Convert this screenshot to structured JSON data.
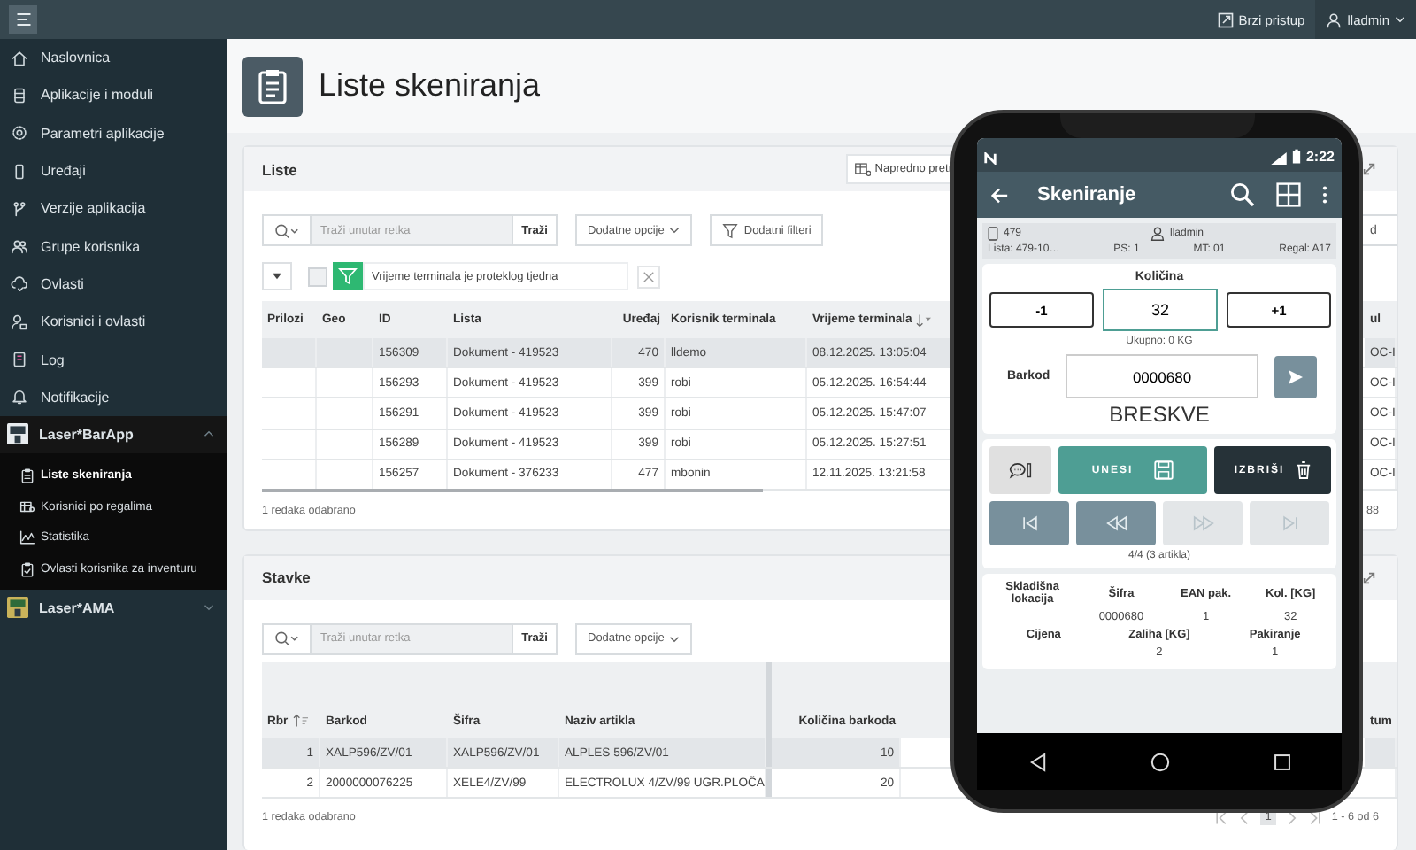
{
  "topbar": {
    "quick_access": "Brzi pristup",
    "user": "lladmin"
  },
  "sidebar": {
    "items": [
      {
        "label": "Naslovnica",
        "selected": false
      },
      {
        "label": "Aplikacije i moduli",
        "selected": false
      },
      {
        "label": "Parametri aplikacije",
        "selected": false
      },
      {
        "label": "Uređaji",
        "selected": false
      },
      {
        "label": "Verzije aplikacija",
        "selected": false
      },
      {
        "label": "Grupe korisnika",
        "selected": false
      },
      {
        "label": "Ovlasti",
        "selected": false
      },
      {
        "label": "Korisnici i ovlasti",
        "selected": false
      },
      {
        "label": "Log",
        "selected": false
      },
      {
        "label": "Notifikacije",
        "selected": false
      }
    ],
    "groups": [
      {
        "label": "Laser*BarApp",
        "expanded": true,
        "children": [
          {
            "label": "Liste skeniranja",
            "selected": true
          },
          {
            "label": "Korisnici po regalima",
            "selected": false
          },
          {
            "label": "Statistika",
            "selected": false
          },
          {
            "label": "Ovlasti korisnika za inventuru",
            "selected": false
          }
        ]
      },
      {
        "label": "Laser*AMA",
        "expanded": false
      }
    ]
  },
  "page": {
    "title": "Liste skeniranja"
  },
  "liste": {
    "title": "Liste",
    "advanced_search": "Napredno pretr",
    "search_placeholder": "Traži unutar retka",
    "search_button": "Traži",
    "options": "Dodatne opcije",
    "filters": "Dodatni filteri",
    "side_button": "d",
    "filter": {
      "text": "Vrijeme terminala je proteklog tjedna",
      "checked": false
    },
    "columns": [
      {
        "label": "Prilozi",
        "sorted": false
      },
      {
        "label": "Geo",
        "sorted": false
      },
      {
        "label": "ID",
        "sorted": false
      },
      {
        "label": "Lista",
        "sorted": false
      },
      {
        "label": "Uređaj",
        "sorted": false
      },
      {
        "label": "Korisnik terminala",
        "sorted": false
      },
      {
        "label": "Vrijeme terminala",
        "sorted": true
      },
      {
        "label": "ul",
        "sorted": false
      }
    ],
    "rows": [
      {
        "cells": [
          "",
          "",
          "156309",
          "Dokument - 419523",
          "470",
          "lldemo",
          "08.12.2025. 13:05:04",
          "OC-I"
        ],
        "selected": true
      },
      {
        "cells": [
          "",
          "",
          "156293",
          "Dokument - 419523",
          "399",
          "robi",
          "05.12.2025. 16:54:44",
          "OC-I"
        ],
        "selected": false
      },
      {
        "cells": [
          "",
          "",
          "156291",
          "Dokument - 419523",
          "399",
          "robi",
          "05.12.2025. 15:47:07",
          "OC-I"
        ],
        "selected": false
      },
      {
        "cells": [
          "",
          "",
          "156289",
          "Dokument - 419523",
          "399",
          "robi",
          "05.12.2025. 15:27:51",
          "OC-I"
        ],
        "selected": false
      },
      {
        "cells": [
          "",
          "",
          "156257",
          "Dokument - 376233",
          "477",
          "mbonin",
          "12.11.2025. 13:21:58",
          "OC-I"
        ],
        "selected": false
      }
    ],
    "footer": "1 redaka odabrano",
    "pager": "88"
  },
  "stavke": {
    "title": "Stavke",
    "search_placeholder": "Traži unutar retka",
    "search_button": "Traži",
    "options": "Dodatne opcije",
    "columns": [
      {
        "label": "Rbr",
        "sorted": true
      },
      {
        "label": "Barkod",
        "sorted": false
      },
      {
        "label": "Šifra",
        "sorted": false
      },
      {
        "label": "Naziv artikla",
        "sorted": false
      },
      {
        "label": "Količina barkoda",
        "sorted": false
      },
      {
        "label": "tum",
        "sorted": false
      }
    ],
    "rows": [
      {
        "cells": [
          "1",
          "XALP596/ZV/01",
          "XALP596/ZV/01",
          "ALPLES 596/ZV/01",
          "10",
          ""
        ],
        "selected": true
      },
      {
        "cells": [
          "2",
          "2000000076225",
          "XELE4/ZV/99",
          "ELECTROLUX 4/ZV/99 UGR.PLOČA",
          "20",
          ""
        ],
        "selected": false
      }
    ],
    "footer": "1 redaka odabrano",
    "pagination": {
      "pages": [
        {
          "label": "1",
          "selected": true
        }
      ],
      "range": "1 - 6 od 6"
    }
  },
  "phone": {
    "time": "2:22",
    "title": "Skeniranje",
    "device": "479",
    "user": "lladmin",
    "info": [
      "Lista: 479-10…",
      "PS: 1",
      "MT: 01",
      "Regal: A17"
    ],
    "quantity_label": "Količina",
    "minus": "-1",
    "quantity": "32",
    "plus": "+1",
    "total": "Ukupno: 0 KG",
    "barcode_label": "Barkod",
    "barcode": "0000680",
    "article": "BRESKVE",
    "enter": "UNESI",
    "delete": "IZBRIŠI",
    "nav": [
      {
        "kind": "first",
        "disabled": false
      },
      {
        "kind": "prev",
        "disabled": false
      },
      {
        "kind": "next",
        "disabled": true
      },
      {
        "kind": "last",
        "disabled": true
      }
    ],
    "position": "4/4 (3 artikla)",
    "details_1": [
      {
        "label": "Skladišna lokacija"
      },
      {
        "label": "Šifra",
        "value": "0000680"
      },
      {
        "label": "EAN pak.",
        "value": "1"
      },
      {
        "label": "Kol. [KG]",
        "value": "32"
      }
    ],
    "details_2": [
      {
        "label": "Cijena"
      },
      {
        "label": "Zaliha [KG]",
        "value": "2"
      },
      {
        "label": "Pakiranje",
        "value": "1"
      }
    ]
  }
}
